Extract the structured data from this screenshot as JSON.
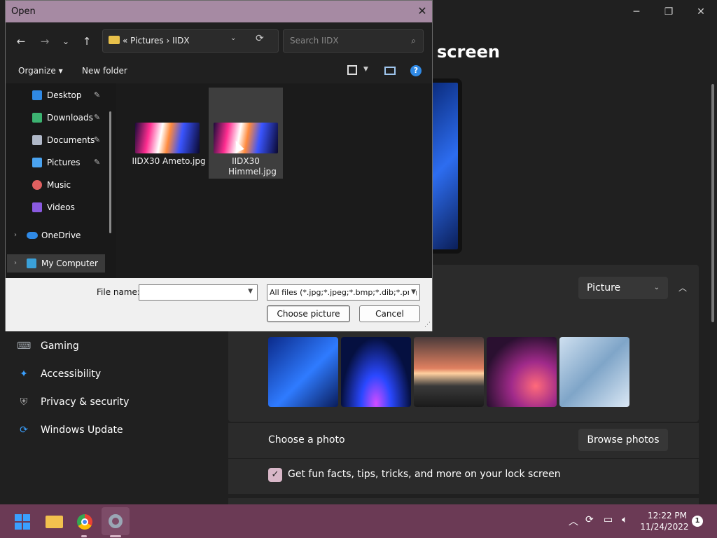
{
  "settings": {
    "title": "screen",
    "minimize_icon": "─",
    "restore_icon": "❐",
    "close_icon": "✕",
    "nav": [
      {
        "label": "Gaming",
        "icon": "gamepad-icon",
        "glyph": "⌨",
        "color": "#9aa0a6"
      },
      {
        "label": "Accessibility",
        "icon": "accessibility-icon",
        "glyph": "✦",
        "color": "#3aa0ff"
      },
      {
        "label": "Privacy & security",
        "icon": "shield-icon",
        "glyph": "⛨",
        "color": "#aaaaaa"
      },
      {
        "label": "Windows Update",
        "icon": "update-icon",
        "glyph": "⟳",
        "color": "#3aa0ff"
      }
    ],
    "personalize_select": "Picture",
    "choose_photo_label": "Choose a photo",
    "browse_button": "Browse photos",
    "fun_facts_label": "Get fun facts, tips, tricks, and more on your lock screen",
    "fun_facts_checked": true,
    "thumbnails": [
      "wallpaper-bloom-blue",
      "wallpaper-glow-dark",
      "wallpaper-sunset-lake",
      "wallpaper-swirl-purple",
      "wallpaper-bloom-light"
    ]
  },
  "dialog": {
    "title": "Open",
    "close_icon": "✕",
    "back_icon": "←",
    "forward_icon": "→",
    "recent_icon": "⌄",
    "up_icon": "↑",
    "address_path": "« Pictures › IIDX",
    "search_placeholder": "Search IIDX",
    "toolbar": {
      "organize": "Organize ▾",
      "new_folder": "New folder",
      "help": "?"
    },
    "nav_pane": [
      {
        "label": "Desktop",
        "icon": "desktop-icon",
        "color": "#2f89e5",
        "pinned": true
      },
      {
        "label": "Downloads",
        "icon": "downloads-icon",
        "color": "#3cb371",
        "pinned": true
      },
      {
        "label": "Documents",
        "icon": "documents-icon",
        "color": "#b0b8c8",
        "pinned": true
      },
      {
        "label": "Pictures",
        "icon": "pictures-icon",
        "color": "#4aa3f0",
        "pinned": true
      },
      {
        "label": "Music",
        "icon": "music-icon",
        "color": "#e06060",
        "pinned": false
      },
      {
        "label": "Videos",
        "icon": "videos-icon",
        "color": "#8a5ae0",
        "pinned": false
      }
    ],
    "onedrive": "OneDrive",
    "my_computer": "My Computer",
    "files": [
      {
        "name": "IIDX30 Ameto.jpg",
        "selected": false
      },
      {
        "name": "IIDX30 Himmel.jpg",
        "selected": true
      }
    ],
    "file_name_label": "File name:",
    "file_name_value": "",
    "filter": "All files (*.jpg;*.jpeg;*.bmp;*.dib;*.png",
    "choose_button": "Choose picture",
    "cancel_button": "Cancel",
    "pin_icon": "📌"
  },
  "taskbar": {
    "time": "12:22 PM",
    "date": "11/24/2022",
    "notification_count": "1",
    "apps": [
      "start-icon",
      "file-explorer-icon",
      "chrome-icon",
      "settings-icon"
    ],
    "tray_icons": [
      "chevron-up-icon",
      "sync-icon",
      "network-icon",
      "volume-icon"
    ]
  }
}
